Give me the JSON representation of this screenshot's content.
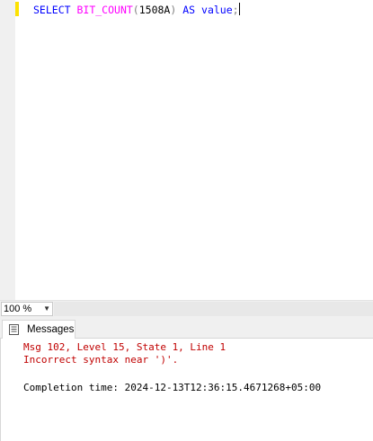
{
  "editor": {
    "tokens": {
      "select": "SELECT",
      "func": "BIT_COUNT",
      "open_paren": "(",
      "arg": "1508A",
      "close_paren": ")",
      "as": "AS",
      "alias": "value",
      "semicolon": ";"
    }
  },
  "zoom": {
    "value": "100 %"
  },
  "results": {
    "tab_label": "Messages",
    "error_line_1": "Msg 102, Level 15, State 1, Line 1",
    "error_line_2": "Incorrect syntax near ')'.",
    "completion_text": "Completion time: 2024-12-13T12:36:15.4671268+05:00"
  },
  "colors": {
    "keyword": "#0000ff",
    "function": "#ff00ff",
    "operator": "#808080",
    "error": "#c00000",
    "change_marker": "#fce100"
  }
}
